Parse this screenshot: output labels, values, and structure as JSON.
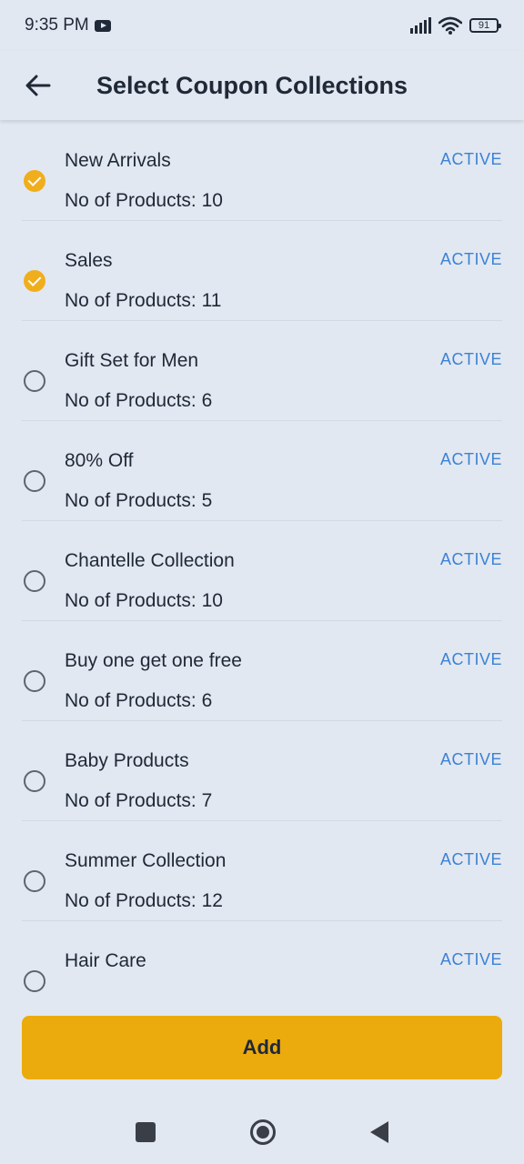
{
  "status_bar": {
    "time": "9:35 PM",
    "battery": "91"
  },
  "app_bar": {
    "title": "Select Coupon Collections"
  },
  "collections": [
    {
      "name": "New Arrivals",
      "count": "No of Products: 10",
      "status": "ACTIVE",
      "checked": true
    },
    {
      "name": "Sales",
      "count": "No of Products: 11",
      "status": "ACTIVE",
      "checked": true
    },
    {
      "name": "Gift Set for Men",
      "count": "No of Products: 6",
      "status": "ACTIVE",
      "checked": false
    },
    {
      "name": "80% Off",
      "count": "No of Products: 5",
      "status": "ACTIVE",
      "checked": false
    },
    {
      "name": "Chantelle Collection",
      "count": "No of Products: 10",
      "status": "ACTIVE",
      "checked": false
    },
    {
      "name": "Buy one get one free",
      "count": "No of Products: 6",
      "status": "ACTIVE",
      "checked": false
    },
    {
      "name": "Baby Products",
      "count": "No of Products: 7",
      "status": "ACTIVE",
      "checked": false
    },
    {
      "name": "Summer Collection",
      "count": "No of Products: 12",
      "status": "ACTIVE",
      "checked": false
    },
    {
      "name": "Hair Care",
      "count": "",
      "status": "ACTIVE",
      "checked": false
    }
  ],
  "footer": {
    "add_label": "Add"
  },
  "colors": {
    "accent": "#ebab0d",
    "status_active": "#3b82d6",
    "background": "#e2e8f1"
  },
  "icons": {
    "back": "arrow-left-icon",
    "checked": "check-circle-icon",
    "unchecked": "circle-outline-icon"
  }
}
